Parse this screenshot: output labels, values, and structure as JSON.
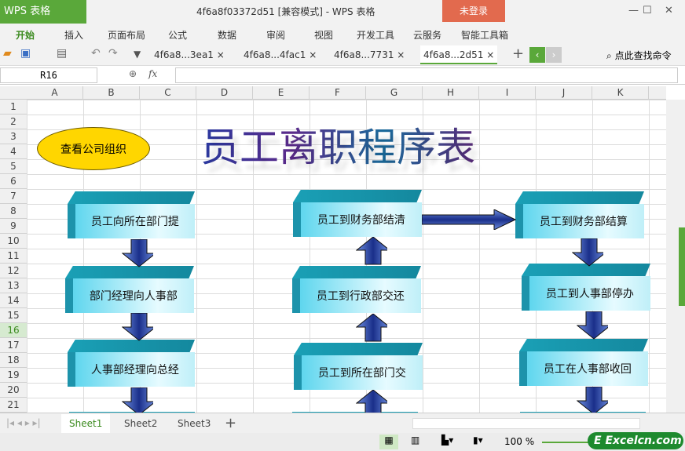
{
  "app": {
    "logo": "WPS 表格",
    "title": "4f6a8f03372d51 [兼容模式] - WPS 表格",
    "login": "未登录"
  },
  "menu": [
    "开始",
    "插入",
    "页面布局",
    "公式",
    "数据",
    "审阅",
    "视图",
    "开发工具",
    "云服务",
    "智能工具箱"
  ],
  "tabs": [
    "4f6a8...3ea1",
    "4f6a8...4fac1",
    "4f6a8...7731",
    "4f6a8...2d51"
  ],
  "search": "点此查找命令",
  "namebox": "R16",
  "fx": "fx",
  "columns": [
    "A",
    "B",
    "C",
    "D",
    "E",
    "F",
    "G",
    "H",
    "I",
    "J",
    "K"
  ],
  "rows": [
    "1",
    "2",
    "3",
    "4",
    "5",
    "6",
    "7",
    "8",
    "9",
    "10",
    "11",
    "12",
    "13",
    "14",
    "15",
    "16",
    "17",
    "18",
    "19",
    "20",
    "21"
  ],
  "sheet": {
    "title": "员工离职程序表",
    "ellipse": "查看公司组织",
    "boxes": [
      "员工向所在部门提",
      "部门经理向人事部",
      "人事部经理向总经",
      "员工到财务部结清",
      "员工到行政部交还",
      "员工到所在部门交",
      "员工到财务部结算",
      "员工到人事部停办",
      "员工在人事部收回"
    ]
  },
  "sheets": [
    "Sheet1",
    "Sheet2",
    "Sheet3"
  ],
  "zoom": "100 %",
  "watermark": "Excelcn.com",
  "colors": {
    "accent": "#5aa83a",
    "login": "#e26a4e",
    "ellipse": "#ffd600"
  }
}
